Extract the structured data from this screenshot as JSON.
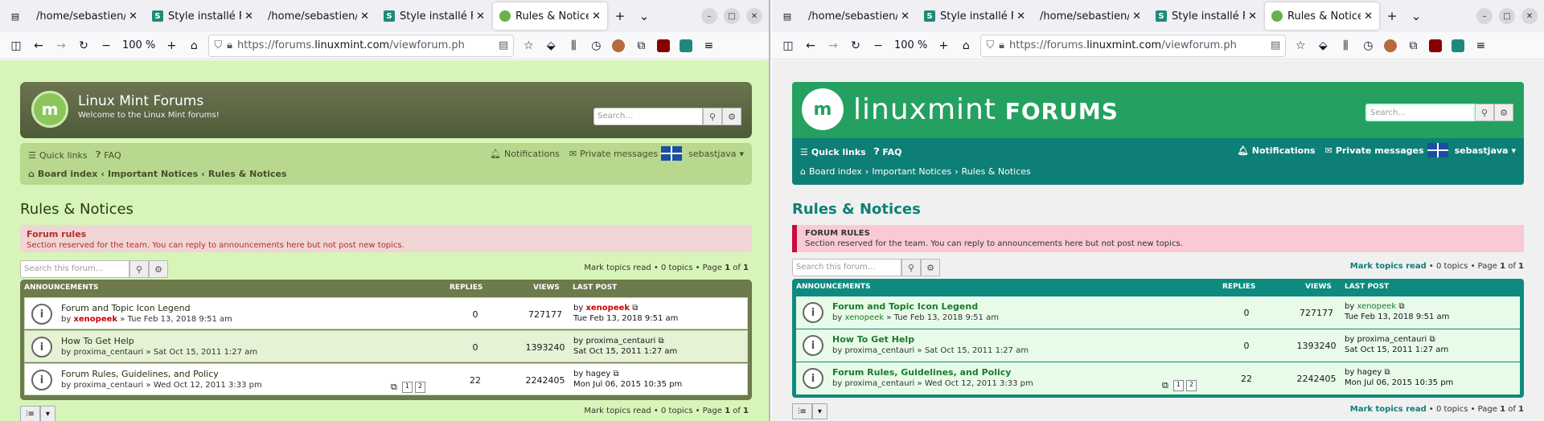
{
  "left": {
    "tabs": [
      {
        "label": "/home/sebastien/F",
        "icon": "none"
      },
      {
        "label": "Style installé Fr",
        "icon": "s"
      },
      {
        "label": "/home/sebastien/F",
        "icon": "none"
      },
      {
        "label": "Style installé Fr",
        "icon": "s"
      },
      {
        "label": "Rules & Notices",
        "icon": "mint"
      }
    ],
    "zoom": "100 %",
    "url_prefix": "https://forums.",
    "url_domain": "linuxmint.com",
    "url_path": "/viewforum.ph",
    "site_title": "Linux Mint Forums",
    "site_sub": "Welcome to the Linux Mint forums!",
    "search_placeholder": "Search…",
    "quick_links": "Quick links",
    "faq": "FAQ",
    "notifications": "Notifications",
    "private_messages": "Private messages",
    "username": "sebastjava",
    "crumb1": "Board index",
    "crumb2": "Important Notices",
    "crumb3": "Rules & Notices",
    "page_title": "Rules & Notices",
    "rules_title": "Forum rules",
    "rules_text": "Section reserved for the team. You can reply to announcements here but not post new topics.",
    "forum_search_placeholder": "Search this forum…",
    "mark_read": "Mark topics read",
    "pagination_text": " • 0 topics • Page ",
    "page_a": "1",
    "of": " of ",
    "page_b": "1",
    "col_announce": "ANNOUNCEMENTS",
    "col_replies": "REPLIES",
    "col_views": "VIEWS",
    "col_lastpost": "LAST POST",
    "topics": [
      {
        "title": "Forum and Topic Icon Legend",
        "by": "by ",
        "author": "xenopeek",
        "date": " » Tue Feb 13, 2018 9:51 am",
        "replies": "0",
        "views": "727177",
        "lp_by": "by ",
        "lp_author": "xenopeek",
        "lp_date": "Tue Feb 13, 2018 9:51 am"
      },
      {
        "title": "How To Get Help",
        "by": "by ",
        "author": "proxima_centauri",
        "date": " » Sat Oct 15, 2011 1:27 am",
        "replies": "0",
        "views": "1393240",
        "lp_by": "by ",
        "lp_author": "proxima_centauri",
        "lp_date": "Sat Oct 15, 2011 1:27 am"
      },
      {
        "title": "Forum Rules, Guidelines, and Policy",
        "by": "by ",
        "author": "proxima_centauri",
        "date": " » Wed Oct 12, 2011 3:33 pm",
        "replies": "22",
        "views": "2242405",
        "lp_by": "by ",
        "lp_author": "hagey",
        "lp_date": "Mon Jul 06, 2015 10:35 pm"
      }
    ],
    "page_links": [
      "1",
      "2"
    ]
  },
  "right": {
    "tabs": [
      {
        "label": "/home/sebastien/F",
        "icon": "none"
      },
      {
        "label": "Style installé Fr",
        "icon": "s"
      },
      {
        "label": "/home/sebastien/F",
        "icon": "none"
      },
      {
        "label": "Style installé Fr",
        "icon": "s"
      },
      {
        "label": "Rules & Notices",
        "icon": "mint"
      }
    ],
    "zoom": "100 %",
    "url_prefix": "https://forums.",
    "url_domain": "linuxmint.com",
    "url_path": "/viewforum.ph",
    "brand": "linuxmint",
    "brand2": " FORUMS",
    "search_placeholder": "Search…",
    "quick_links": "Quick links",
    "faq": "FAQ",
    "notifications": "Notifications",
    "private_messages": "Private messages",
    "username": "sebastjava",
    "crumb1": "Board index",
    "crumb2": "Important Notices",
    "crumb3": "Rules & Notices",
    "page_title": "Rules & Notices",
    "rules_title": "FORUM RULES",
    "rules_text": "Section reserved for the team. You can reply to announcements here but not post new topics.",
    "forum_search_placeholder": "Search this forum…",
    "mark_read": "Mark topics read",
    "pagination_text": " • 0 topics • Page ",
    "page_a": "1",
    "of": " of ",
    "page_b": "1",
    "col_announce": "ANNOUNCEMENTS",
    "col_replies": "REPLIES",
    "col_views": "VIEWS",
    "col_lastpost": "LAST POST",
    "topics": [
      {
        "title": "Forum and Topic Icon Legend",
        "by": "by ",
        "author": "xenopeek",
        "date": " » Tue Feb 13, 2018 9:51 am",
        "replies": "0",
        "views": "727177",
        "lp_by": "by ",
        "lp_author": "xenopeek",
        "lp_date": "Tue Feb 13, 2018 9:51 am"
      },
      {
        "title": "How To Get Help",
        "by": "by ",
        "author": "proxima_centauri",
        "date": " » Sat Oct 15, 2011 1:27 am",
        "replies": "0",
        "views": "1393240",
        "lp_by": "by ",
        "lp_author": "proxima_centauri",
        "lp_date": "Sat Oct 15, 2011 1:27 am"
      },
      {
        "title": "Forum Rules, Guidelines, and Policy",
        "by": "by ",
        "author": "proxima_centauri",
        "date": " » Wed Oct 12, 2011 3:33 pm",
        "replies": "22",
        "views": "2242405",
        "lp_by": "by ",
        "lp_author": "hagey",
        "lp_date": "Mon Jul 06, 2015 10:35 pm"
      }
    ],
    "page_links": [
      "1",
      "2"
    ]
  },
  "colors": {
    "left_bg": "#d7f5b8",
    "left_header": "#5e6a43",
    "right_green": "#24a160",
    "right_teal": "#0e7f76",
    "rules_red": "#c70d3a"
  },
  "icons": [
    "tab-list-icon",
    "close-icon",
    "new-tab-icon",
    "chevron-down-icon",
    "minimize-icon",
    "maximize-icon",
    "sidebar-icon",
    "back-icon",
    "forward-icon",
    "reload-icon",
    "zoom-out-icon",
    "zoom-in-icon",
    "home-icon",
    "shield-icon",
    "lock-icon",
    "reader-icon",
    "bookmark-star-icon",
    "pocket-icon",
    "library-icon",
    "history-icon",
    "extension-icon",
    "menu-icon",
    "search-icon",
    "gear-icon",
    "bell-icon",
    "envelope-icon",
    "topic-locked-icon"
  ]
}
